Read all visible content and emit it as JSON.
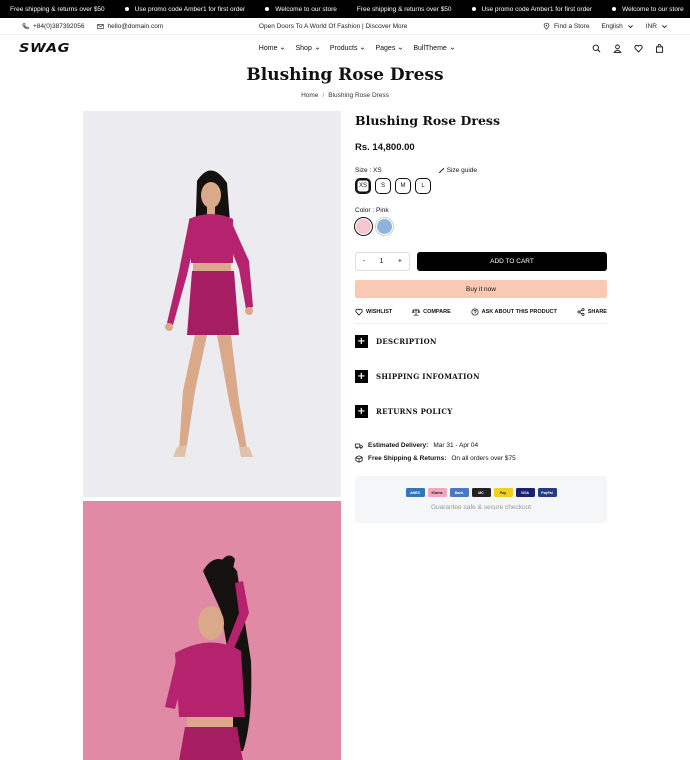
{
  "announcement": [
    "Free shipping & returns over $50",
    "Use promo code Amber1 for first order",
    "Welcome to our store",
    "Free shipping & returns over $50",
    "Use promo code Amber1 for first order",
    "Welcome to our store"
  ],
  "topbar": {
    "phone": "+84(0)387392056",
    "email": "hello@domain.com",
    "center_text": "Open Doors To A World Of Fashion | Discover More",
    "find_store": "Find a Store",
    "language": "English",
    "currency": "INR"
  },
  "header": {
    "logo": "SWAG",
    "nav": [
      "Home",
      "Shop",
      "Products",
      "Pages",
      "BullTheme"
    ]
  },
  "page": {
    "title": "Blushing Rose Dress",
    "breadcrumb": [
      "Home",
      "Blushing Rose Dress"
    ]
  },
  "product": {
    "title": "Blushing Rose Dress",
    "price": "Rs. 14,800.00",
    "size_label": "Size : XS",
    "size_guide": "Size guide",
    "sizes": [
      "XS",
      "S",
      "M",
      "L"
    ],
    "selected_size": "XS",
    "color_label": "Color : Pink",
    "colors": [
      "#f5c6d0",
      "#8fb4dc"
    ],
    "quantity": "1",
    "qty_minus": "-",
    "qty_plus": "+",
    "add_to_cart": "ADD TO CART",
    "buy_now": "Buy it now",
    "actions": [
      "WISHLIST",
      "COMPARE",
      "ASK ABOUT THIS PRODUCT",
      "SHARE"
    ],
    "accordions": [
      "DESCRIPTION",
      "SHIPPING INFOMATION",
      "RETURNS POLICY"
    ],
    "delivery_label": "Estimated Delivery:",
    "delivery_value": "Mar 31 - Apr 04",
    "shipping_label": "Free Shipping & Returns:",
    "shipping_value": "On all orders over $75",
    "payments": [
      "AMEX",
      "Klarna",
      "Bank",
      "MC",
      "Pay",
      "VISA",
      "PayPal"
    ],
    "guarantee": "Guarantee safe & secure checkout"
  },
  "colors": {
    "accent": "#000000",
    "buy_now_bg": "#f9c9b4",
    "dress": "#b5226d"
  }
}
